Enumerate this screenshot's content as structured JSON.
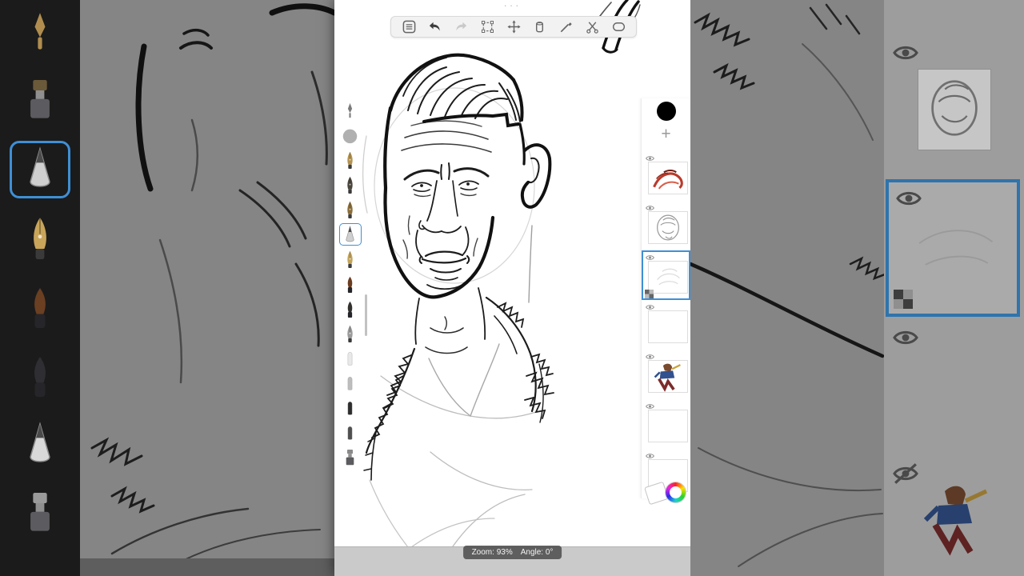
{
  "app": {
    "handle_dots": "···",
    "toolbar": {
      "items": [
        {
          "name": "menu",
          "glyph": "menu",
          "enabled": true
        },
        {
          "name": "undo",
          "glyph": "undo",
          "enabled": true
        },
        {
          "name": "redo",
          "glyph": "redo",
          "enabled": false
        },
        {
          "name": "marquee-select",
          "glyph": "marquee",
          "enabled": true
        },
        {
          "name": "transform-move",
          "glyph": "move",
          "enabled": true
        },
        {
          "name": "eraser",
          "glyph": "eraser",
          "enabled": true
        },
        {
          "name": "pen-tool",
          "glyph": "pen",
          "enabled": true
        },
        {
          "name": "cut",
          "glyph": "cut",
          "enabled": true
        },
        {
          "name": "lasso",
          "glyph": "lasso",
          "enabled": true
        }
      ]
    },
    "brush_rail": {
      "items": [
        {
          "shape": "pen",
          "color": "#7a7a7a",
          "selected": false
        },
        {
          "shape": "blob",
          "color": "#a2a2a2",
          "selected": false
        },
        {
          "shape": "nib",
          "color": "#b3924f",
          "selected": false
        },
        {
          "shape": "nib",
          "color": "#4a463c",
          "selected": false
        },
        {
          "shape": "nib",
          "color": "#8a6d3a",
          "selected": false
        },
        {
          "shape": "cone",
          "color": "#cfcfcf",
          "selected": true
        },
        {
          "shape": "nib",
          "color": "#c2a35c",
          "selected": false
        },
        {
          "shape": "round",
          "color": "#6b3d20",
          "selected": false
        },
        {
          "shape": "round",
          "color": "#33322f",
          "selected": false
        },
        {
          "shape": "nib",
          "color": "#9a9a9a",
          "selected": false
        },
        {
          "shape": "bullet",
          "color": "#e9e9e9",
          "selected": false
        },
        {
          "shape": "bullet",
          "color": "#bdbdbd",
          "selected": false
        },
        {
          "shape": "bullet",
          "color": "#2d2d2d",
          "selected": false
        },
        {
          "shape": "bullet",
          "color": "#4f4f4f",
          "selected": false
        },
        {
          "shape": "stamp",
          "color": "#8a8a8a",
          "selected": false
        }
      ]
    },
    "layers_panel": {
      "foreground_color": "#000000",
      "add_layer_label": "+",
      "layers": [
        {
          "visible": true,
          "thumb": "red-paint",
          "selected": false
        },
        {
          "visible": true,
          "thumb": "face-sketch",
          "selected": false
        },
        {
          "visible": true,
          "thumb": "faint-sketch",
          "selected": true
        },
        {
          "visible": true,
          "thumb": "empty",
          "selected": false
        },
        {
          "visible": true,
          "thumb": "character",
          "selected": false
        },
        {
          "visible": true,
          "thumb": "empty",
          "selected": false
        },
        {
          "visible": true,
          "thumb": "empty",
          "selected": false
        }
      ]
    },
    "status": {
      "zoom_label": "Zoom: 93%",
      "angle_label": "Angle: 0°"
    },
    "colors": {
      "selection_blue": "#3f8fd6",
      "canvas": "#ffffff"
    }
  },
  "left_strip": {
    "items": [
      {
        "shape": "pen",
        "color": "#b08d4f",
        "selected": false
      },
      {
        "shape": "stamp",
        "color": "#6a5a3a",
        "selected": false
      },
      {
        "shape": "cone",
        "color": "#cfcfcf",
        "selected": true
      },
      {
        "shape": "nib",
        "color": "#c9a55a",
        "selected": false
      },
      {
        "shape": "round",
        "color": "#6b3f22",
        "selected": false
      },
      {
        "shape": "round",
        "color": "#2f2f33",
        "selected": false
      },
      {
        "shape": "cone",
        "color": "#d8d8d8",
        "selected": false
      },
      {
        "shape": "stamp",
        "color": "#9a9a9a",
        "selected": false
      }
    ]
  }
}
